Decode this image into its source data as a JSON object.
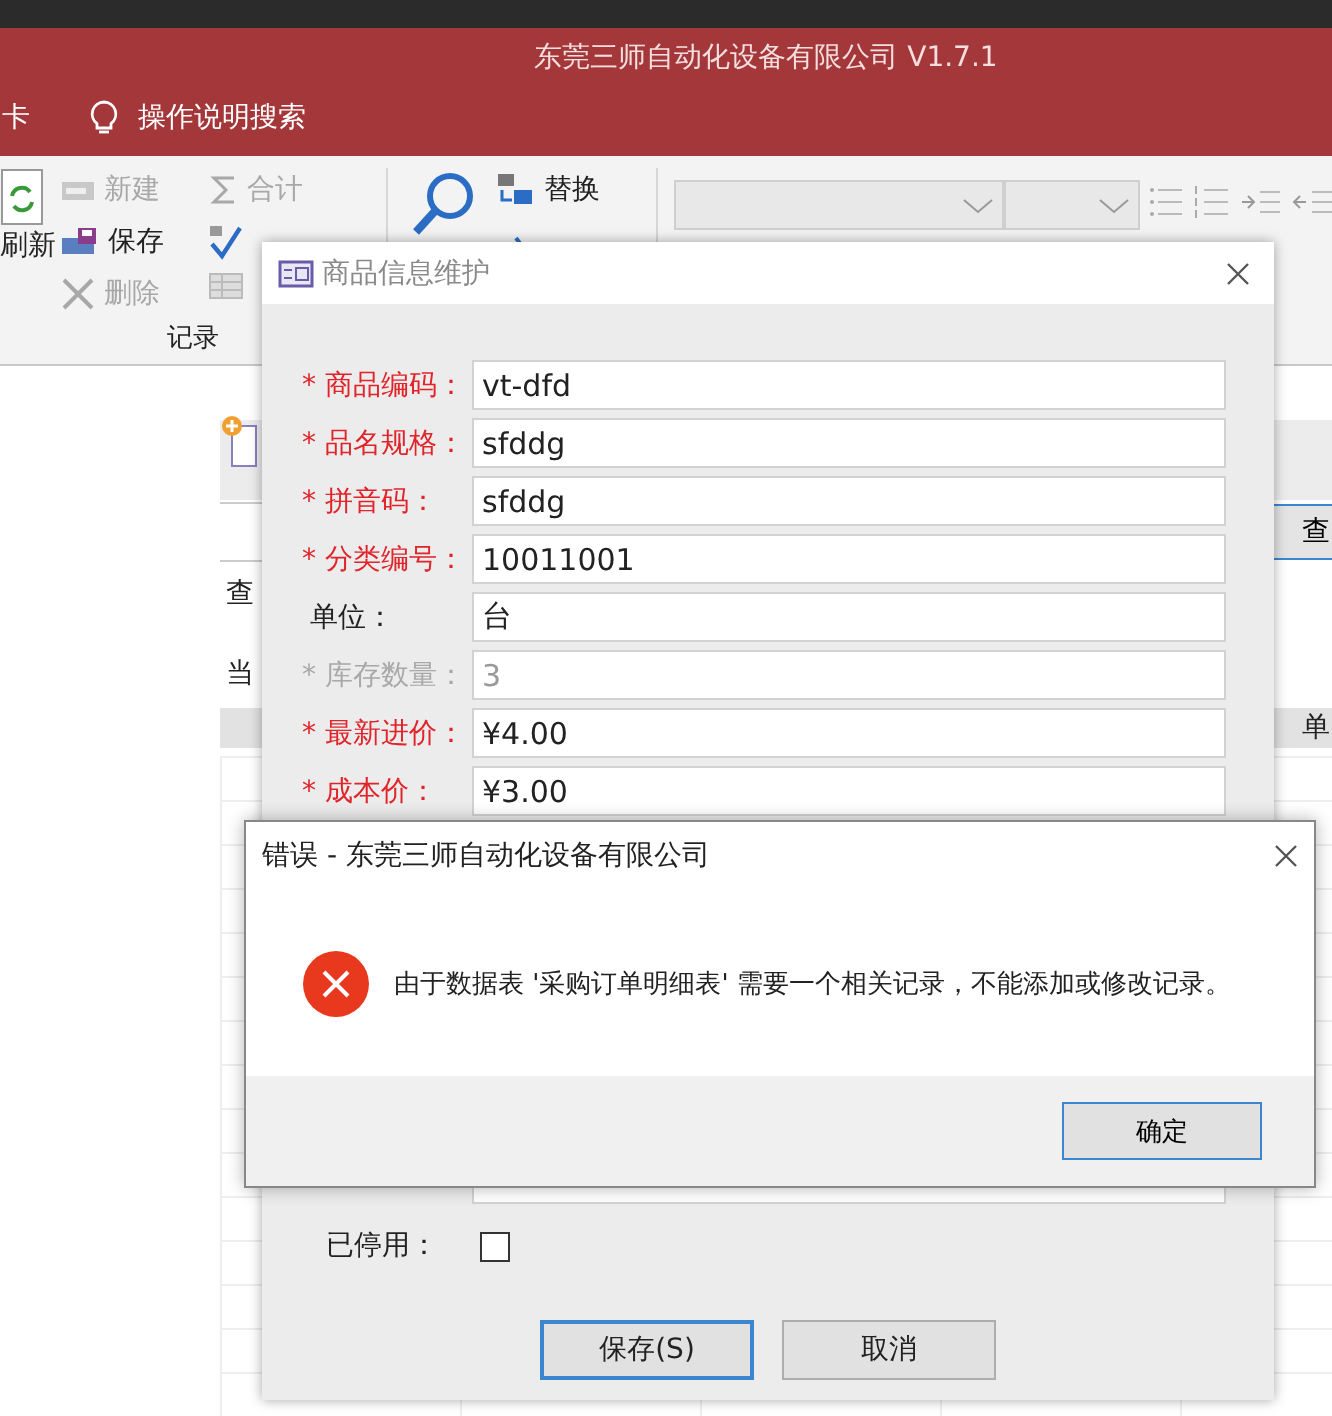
{
  "app_title": "东莞三师自动化设备有限公司 V1.7.1",
  "menu_tabs": [
    {
      "label": "卡",
      "kind": "tab"
    },
    {
      "label": "操作说明搜索",
      "kind": "search"
    }
  ],
  "ribbon": {
    "refresh": "刷新",
    "group_label": "记录",
    "record_buttons": [
      {
        "label": "新建",
        "kind": "new",
        "disabled": true
      },
      {
        "label": "保存",
        "kind": "save",
        "disabled": false
      },
      {
        "label": "删除",
        "kind": "delete",
        "disabled": true
      }
    ],
    "more_buttons": [
      {
        "label": "合计",
        "kind": "sum",
        "disabled": true
      },
      {
        "kind": "spell"
      }
    ],
    "find_buttons": [
      {
        "label": "替换",
        "kind": "replace"
      },
      {
        "kind": "goto"
      }
    ]
  },
  "back_form": {
    "query_label": "查",
    "current_label": "当",
    "query_button": "查",
    "column": "单"
  },
  "goods_dialog": {
    "title": "商品信息维护",
    "fields": [
      {
        "label": "* 商品编码：",
        "value": "vt-dfd",
        "required": true,
        "disabled": false
      },
      {
        "label": "* 品名规格：",
        "value": "sfddg",
        "required": true,
        "disabled": false
      },
      {
        "label": "* 拼音码：",
        "value": "sfddg",
        "required": true,
        "disabled": false
      },
      {
        "label": "* 分类编号：",
        "value": "10011001",
        "required": true,
        "disabled": false
      },
      {
        "label": "单位：",
        "value": "台",
        "required": false,
        "disabled": false
      },
      {
        "label": "* 库存数量：",
        "value": "3",
        "required": true,
        "disabled": true
      },
      {
        "label": "* 最新进价：",
        "value": "¥4.00",
        "required": true,
        "disabled": false
      },
      {
        "label": "* 成本价：",
        "value": "¥3.00",
        "required": true,
        "disabled": false
      }
    ],
    "stopped": {
      "label": "已停用：",
      "checked": false
    },
    "buttons": [
      {
        "label": "保存(S)",
        "focused": true
      },
      {
        "label": "取消",
        "focused": false
      }
    ]
  },
  "error_dialog": {
    "title": "错误 - 东莞三师自动化设备有限公司",
    "message": "由于数据表 '采购订单明细表' 需要一个相关记录，不能添加或修改记录。",
    "button": "确定"
  }
}
